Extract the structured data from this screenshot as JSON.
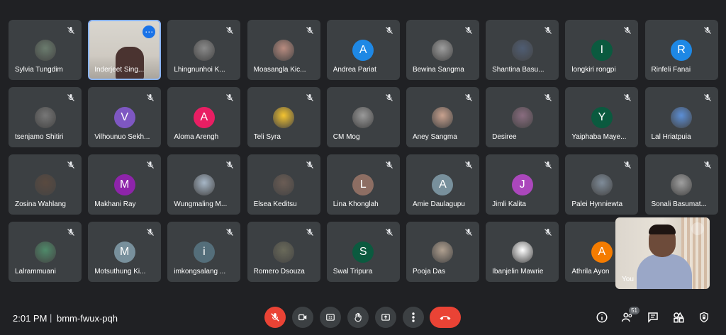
{
  "participants": [
    {
      "name": "Sylvia Tungdim",
      "initial": "",
      "color": "#6b7c6e",
      "photo": true
    },
    {
      "name": "Inderjeet Sing...",
      "initial": "",
      "color": "",
      "photo": false,
      "active": true
    },
    {
      "name": "Lhingnunhoi K...",
      "initial": "",
      "color": "#8a8a8a",
      "photo": true
    },
    {
      "name": "Moasangla Kic...",
      "initial": "",
      "color": "#b98c80",
      "photo": true
    },
    {
      "name": "Andrea Pariat",
      "initial": "A",
      "color": "#1e88e5"
    },
    {
      "name": "Bewina Sangma",
      "initial": "",
      "color": "#9e9e9e",
      "photo": true
    },
    {
      "name": "Shantina Basu...",
      "initial": "",
      "color": "#4f5d73",
      "photo": true
    },
    {
      "name": "longkiri rongpi",
      "initial": "I",
      "color": "#0b5a3f"
    },
    {
      "name": "Rinfeli Fanai",
      "initial": "R",
      "color": "#1e88e5"
    },
    {
      "name": "tsenjamo Shitiri",
      "initial": "",
      "color": "#777",
      "photo": true
    },
    {
      "name": "Vilhounuo Sekh...",
      "initial": "V",
      "color": "#7e57c2"
    },
    {
      "name": "Aloma Arengh",
      "initial": "A",
      "color": "#e91e63"
    },
    {
      "name": "Teli Syra",
      "initial": "",
      "color": "#f4c430",
      "photo": true
    },
    {
      "name": "CM Mog",
      "initial": "",
      "color": "#9a9a9a",
      "photo": true
    },
    {
      "name": "Aney Sangma",
      "initial": "",
      "color": "#c9a28f",
      "photo": true
    },
    {
      "name": "Desiree",
      "initial": "",
      "color": "#8a6d80",
      "photo": true
    },
    {
      "name": "Yaiphaba Maye...",
      "initial": "Y",
      "color": "#0b5a3f"
    },
    {
      "name": "Lal Hriatpuia",
      "initial": "",
      "color": "#5c8fd6",
      "photo": true
    },
    {
      "name": "Zosina Wahlang",
      "initial": "",
      "color": "#5a4a40",
      "photo": true
    },
    {
      "name": "Makhani Ray",
      "initial": "M",
      "color": "#8e24aa"
    },
    {
      "name": "Wungmaling M...",
      "initial": "",
      "color": "#a7b7c7",
      "photo": true
    },
    {
      "name": "Elsea Keditsu",
      "initial": "",
      "color": "#6b5d55",
      "photo": true
    },
    {
      "name": "Lina Khonglah",
      "initial": "L",
      "color": "#8d6e63"
    },
    {
      "name": "Amie Daulagupu",
      "initial": "A",
      "color": "#78909c"
    },
    {
      "name": "Jimli Kalita",
      "initial": "J",
      "color": "#ab47bc"
    },
    {
      "name": "Palei Hynniewta",
      "initial": "",
      "color": "#7f8c99",
      "photo": true
    },
    {
      "name": "Sonali Basumat...",
      "initial": "",
      "color": "#a0a0a0",
      "photo": true
    },
    {
      "name": "Lalrammuani",
      "initial": "",
      "color": "#4f8a6a",
      "photo": true
    },
    {
      "name": "Motsuthung Ki...",
      "initial": "M",
      "color": "#78909c"
    },
    {
      "name": "imkongsalang ...",
      "initial": "i",
      "color": "#546e7a"
    },
    {
      "name": "Romero Dsouza",
      "initial": "",
      "color": "#6a6a5a",
      "photo": true
    },
    {
      "name": "Swal Tripura",
      "initial": "S",
      "color": "#0b5a3f"
    },
    {
      "name": "Pooja Das",
      "initial": "",
      "color": "#b0a090",
      "photo": true
    },
    {
      "name": "Ibanjelin Mawrie",
      "initial": "",
      "color": "#ffffff",
      "photo": true
    },
    {
      "name": "Athrila Ayon",
      "initial": "A",
      "color": "#f57c00"
    }
  ],
  "self_view": {
    "label": "You"
  },
  "meeting": {
    "time": "2:01 PM",
    "separator": "|",
    "code": "bmm-fwux-pqh"
  },
  "people_count": "51"
}
